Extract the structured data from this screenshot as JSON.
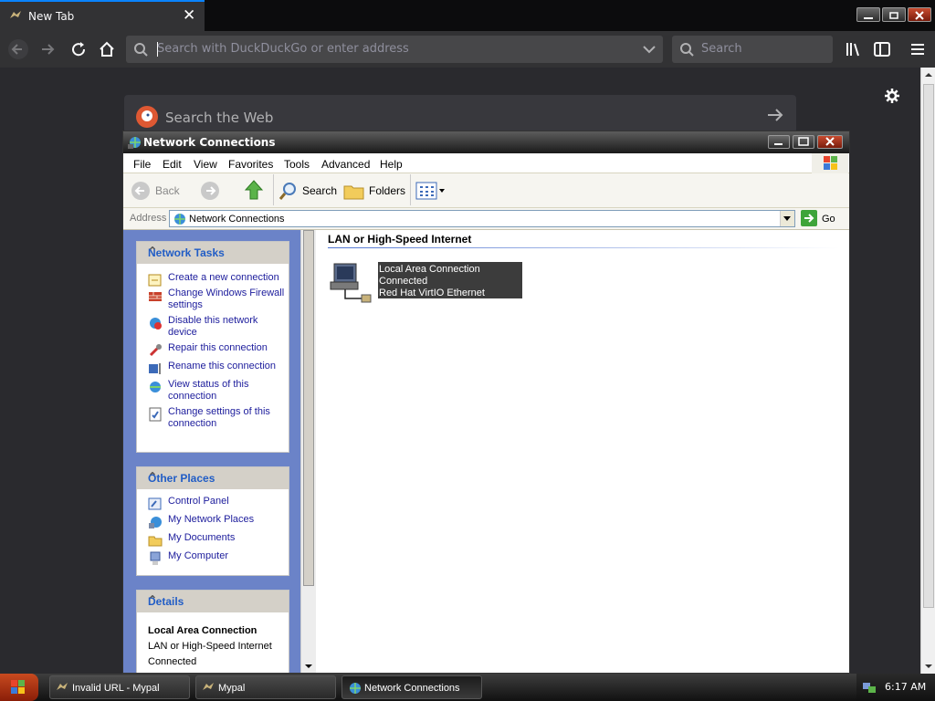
{
  "browser": {
    "tab_title": "New Tab",
    "url_placeholder": "Search with DuckDuckGo or enter address",
    "search_placeholder": "Search",
    "newtab_search_text": "Search the Web"
  },
  "explorer": {
    "title": "Network Connections",
    "menu": [
      "File",
      "Edit",
      "View",
      "Favorites",
      "Tools",
      "Advanced",
      "Help"
    ],
    "toolbar": {
      "back": "Back",
      "search": "Search",
      "folders": "Folders"
    },
    "address_label": "Address",
    "address_value": "Network Connections",
    "go_label": "Go",
    "network_tasks": {
      "header": "Network Tasks",
      "items": [
        "Create a new connection",
        "Change Windows Firewall settings",
        "Disable this network device",
        "Repair this connection",
        "Rename this connection",
        "View status of this connection",
        "Change settings of this connection"
      ]
    },
    "other_places": {
      "header": "Other Places",
      "items": [
        "Control Panel",
        "My Network Places",
        "My Documents",
        "My Computer"
      ]
    },
    "details": {
      "header": "Details",
      "name": "Local Area Connection",
      "line1": "LAN or High-Speed Internet",
      "line2": "Connected"
    },
    "section_title": "LAN or High-Speed Internet",
    "connection": {
      "name": "Local Area Connection",
      "status": "Connected",
      "adapter": "Red Hat VirtIO Ethernet Adapter"
    }
  },
  "taskbar": {
    "items": [
      "Invalid URL - Mypal",
      "Mypal",
      "Network Connections"
    ],
    "clock": "6:17 AM"
  }
}
